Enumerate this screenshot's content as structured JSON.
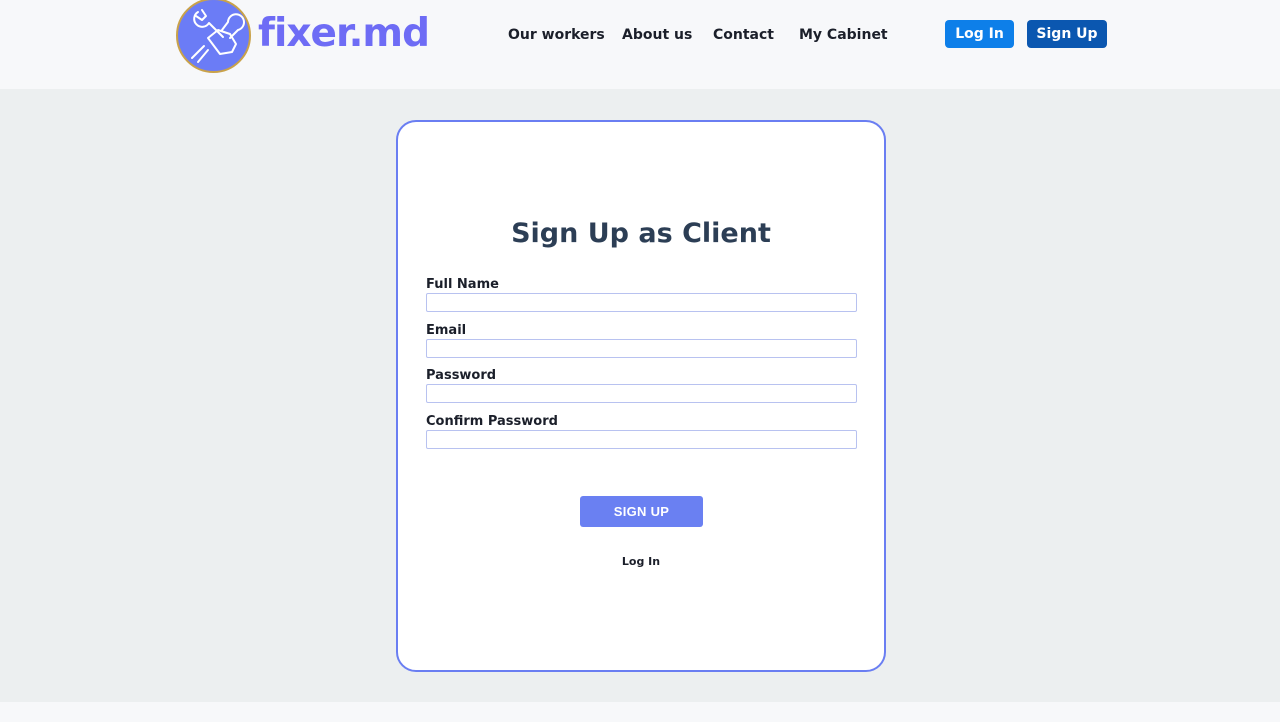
{
  "brand": {
    "name": "fixer.md",
    "logo_icon": "wrench-hand-icon",
    "color": "#6e6cf5",
    "logo_bg": "#6b7cf6"
  },
  "nav": {
    "items": [
      {
        "label": "Our workers"
      },
      {
        "label": "About us"
      },
      {
        "label": "Contact"
      },
      {
        "label": "My Cabinet"
      }
    ]
  },
  "header_buttons": {
    "login_label": "Log In",
    "signup_label": "Sign Up",
    "login_color": "#0d7fe9",
    "signup_color": "#0b57b0"
  },
  "form": {
    "title": "Sign Up as Client",
    "fields": [
      {
        "label": "Full Name",
        "value": ""
      },
      {
        "label": "Email",
        "value": ""
      },
      {
        "label": "Password",
        "value": ""
      },
      {
        "label": "Confirm Password",
        "value": ""
      }
    ],
    "submit_label": "SIGN UP",
    "login_link": "Log In",
    "accent": "#6a80f2"
  }
}
